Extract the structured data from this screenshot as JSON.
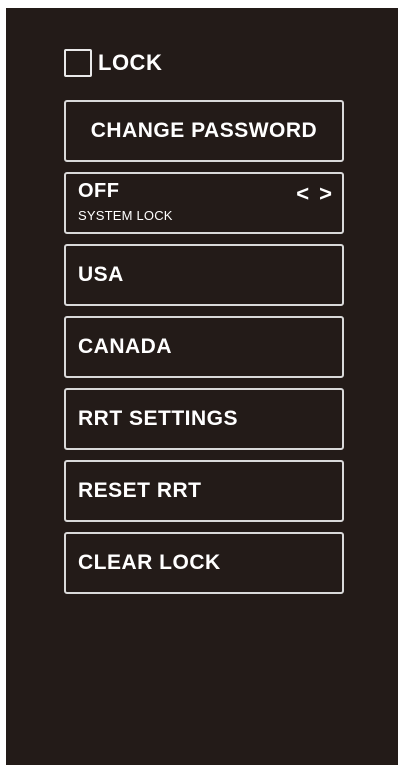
{
  "lock": {
    "label": "LOCK",
    "checked": false
  },
  "buttons": {
    "change_password": "CHANGE PASSWORD",
    "system_lock": {
      "value": "OFF",
      "label": "SYSTEM LOCK",
      "prev": "<",
      "next": ">"
    },
    "usa": "USA",
    "canada": "CANADA",
    "rrt_settings": "RRT SETTINGS",
    "reset_rrt": "RESET RRT",
    "clear_lock": "CLEAR LOCK"
  },
  "colors": {
    "background": "#231b18",
    "border": "#d9d9d9",
    "text": "#ffffff"
  }
}
